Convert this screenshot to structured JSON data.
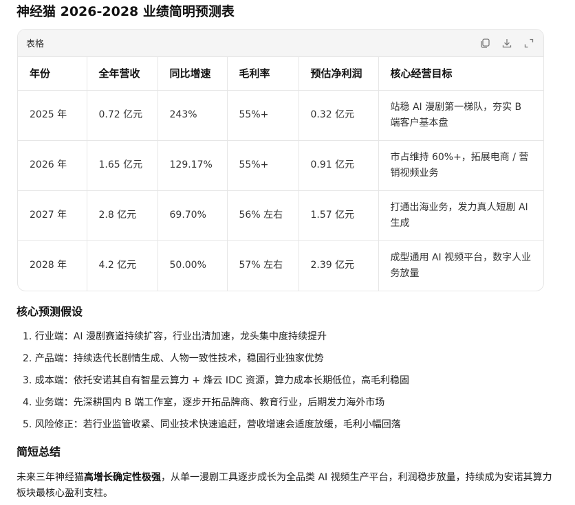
{
  "title": "神经猫 2026-2028 业绩简明预测表",
  "table_card": {
    "label": "表格",
    "icons": [
      "copy-icon",
      "download-icon",
      "expand-icon"
    ],
    "headers": [
      "年份",
      "全年营收",
      "同比增速",
      "毛利率",
      "预估净利润",
      "核心经营目标"
    ],
    "rows": [
      [
        "2025 年",
        "0.72 亿元",
        "243%",
        "55%+",
        "0.32 亿元",
        "站稳 AI 漫剧第一梯队，夯实 B 端客户基本盘"
      ],
      [
        "2026 年",
        "1.65 亿元",
        "129.17%",
        "55%+",
        "0.91 亿元",
        "市占维持 60%+，拓展电商 / 营销视频业务"
      ],
      [
        "2027 年",
        "2.8 亿元",
        "69.70%",
        "56% 左右",
        "1.57 亿元",
        "打通出海业务，发力真人短剧 AI 生成"
      ],
      [
        "2028 年",
        "4.2 亿元",
        "50.00%",
        "57% 左右",
        "2.39 亿元",
        "成型通用 AI 视频平台，数字人业务放量"
      ]
    ]
  },
  "assumptions": {
    "heading": "核心预测假设",
    "items": [
      "1. 行业端：AI 漫剧赛道持续扩容，行业出清加速，龙头集中度持续提升",
      "2. 产品端：持续迭代长剧情生成、人物一致性技术，稳固行业独家优势",
      "3. 成本端：依托安诺其自有智星云算力 + 烽云 IDC 资源，算力成本长期低位，高毛利稳固",
      "4. 业务端：先深耕国内 B 端工作室，逐步开拓品牌商、教育行业，后期发力海外市场",
      "5. 风险修正：若行业监管收紧、同业技术快速追赶，营收增速会适度放缓，毛利小幅回落"
    ]
  },
  "summary": {
    "heading": "简短总结",
    "before": "未来三年神经猫",
    "bold": "高增长确定性极强",
    "after": "，从单一漫剧工具逐步成长为全品类 AI 视频生产平台，利润稳步放量，持续成为安诺其算力板块最核心盈利支柱。"
  }
}
